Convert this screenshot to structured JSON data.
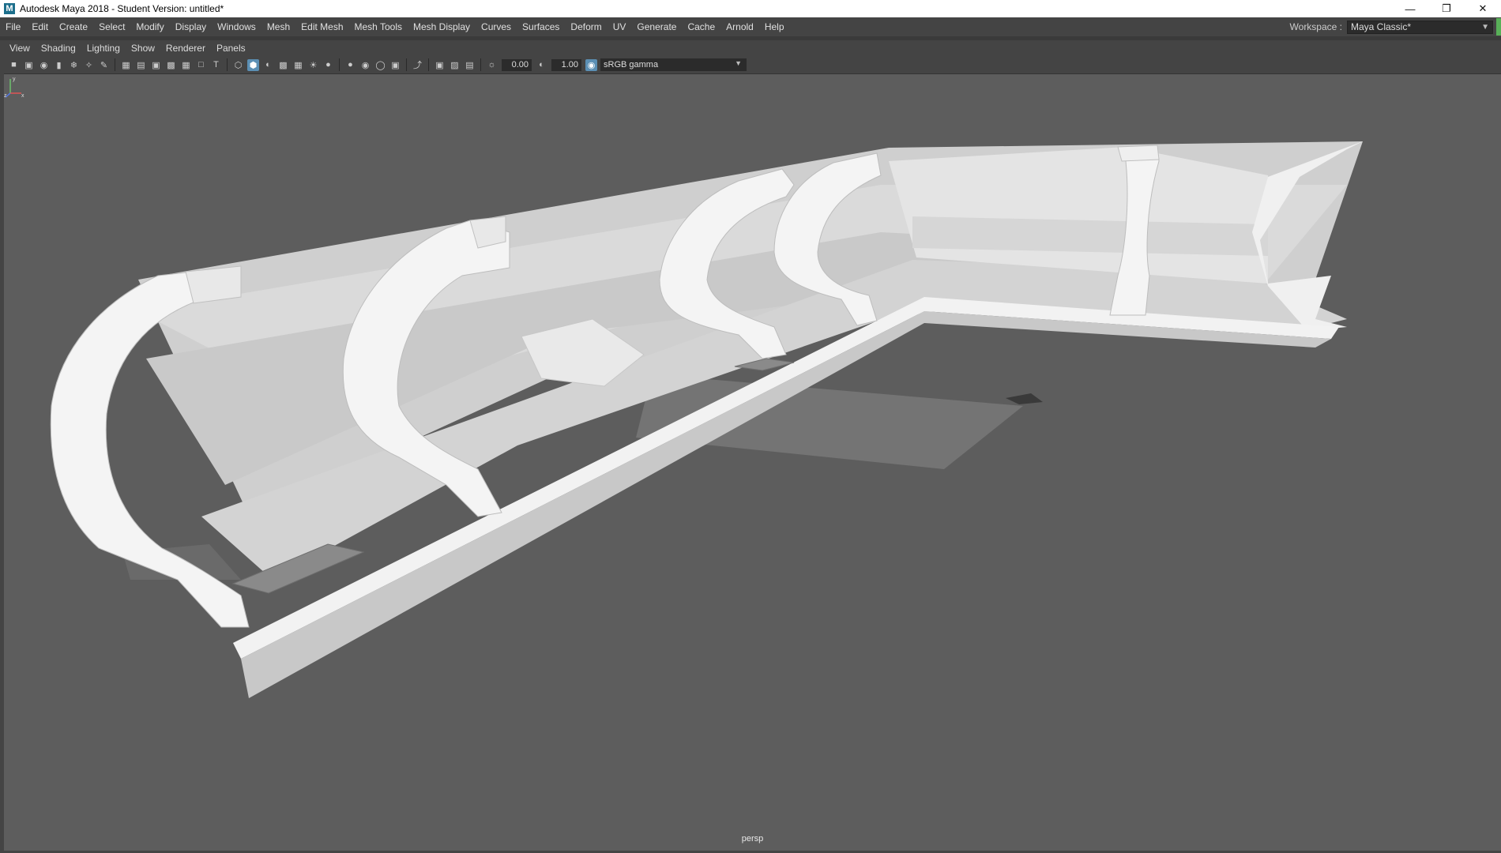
{
  "window": {
    "title": "Autodesk Maya 2018 - Student Version: untitled*",
    "app_icon": "M",
    "controls": [
      "minimize-icon",
      "restore-icon",
      "close-icon"
    ]
  },
  "menubar": {
    "items": [
      "File",
      "Edit",
      "Create",
      "Select",
      "Modify",
      "Display",
      "Windows",
      "Mesh",
      "Edit Mesh",
      "Mesh Tools",
      "Mesh Display",
      "Curves",
      "Surfaces",
      "Deform",
      "UV",
      "Generate",
      "Cache",
      "Arnold",
      "Help"
    ],
    "workspace_label": "Workspace :",
    "workspace_value": "Maya Classic*"
  },
  "panel_menu": {
    "items": [
      "View",
      "Shading",
      "Lighting",
      "Show",
      "Renderer",
      "Panels"
    ]
  },
  "panel_toolbar": {
    "exposure": "0.00",
    "gamma_value": "1.00",
    "color_space": "sRGB gamma"
  },
  "viewport": {
    "camera": "persp",
    "axis_labels": {
      "y": "y",
      "x": "x",
      "z": "z"
    }
  },
  "colors": {
    "viewport_bg": "#5d5d5d",
    "ui_bg": "#444444",
    "accent": "#5b8fb4"
  }
}
